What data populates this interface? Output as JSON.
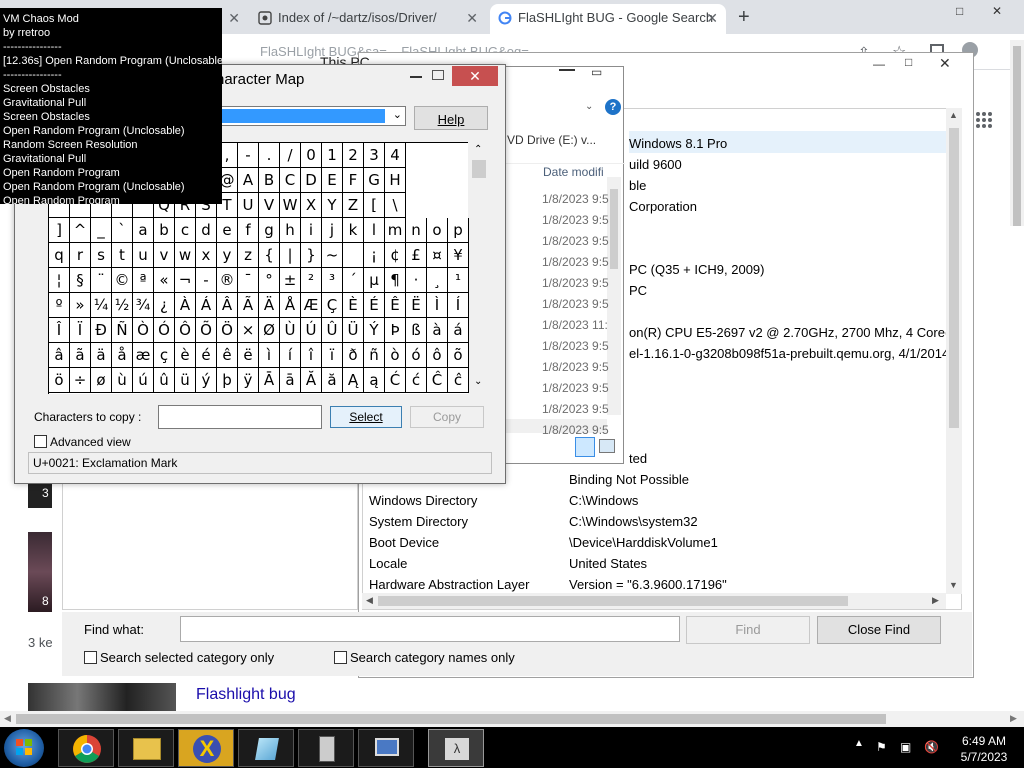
{
  "chrome": {
    "tabs": [
      {
        "label": ""
      },
      {
        "label": "Index of /~dartz/isos/Driver/"
      },
      {
        "label": "FlaSHLIght BUG - Google Search"
      }
    ],
    "address_ghost": "FlaSHLIght BUG&sa=... FlaSHLIght BUG&oq=..."
  },
  "chaos_overlay": {
    "title": "VM Chaos Mod",
    "author": "by rretroo",
    "separator": "----------------",
    "current": "[12.36s] Open Random Program (Unclosable)",
    "history": [
      "Screen Obstacles",
      "Gravitational Pull",
      "Screen Obstacles",
      "Open Random Program (Unclosable)",
      "Random Screen Resolution",
      "Gravitational Pull",
      "Open Random Program",
      "Open Random Program (Unclosable)",
      "Open Random Program"
    ]
  },
  "charmap": {
    "title": "haracter Map",
    "help_label": "Help",
    "copy_label": "Characters to copy :",
    "copy_value": "",
    "select_label": "Select",
    "copy_button": "Copy",
    "advanced_label": "Advanced view",
    "status": "U+0021: Exclamation Mark",
    "rows": [
      [
        "",
        "",
        "",
        "",
        "",
        ")",
        "*",
        "+",
        ",",
        "-",
        ".",
        "/",
        "0",
        "1",
        "2",
        "3",
        "4"
      ],
      [
        "",
        "",
        "",
        "",
        "",
        "=",
        ">",
        "?",
        "@",
        "A",
        "B",
        "C",
        "D",
        "E",
        "F",
        "G",
        "H"
      ],
      [
        "",
        "",
        "",
        "",
        "",
        "Q",
        "R",
        "S",
        "T",
        "U",
        "V",
        "W",
        "X",
        "Y",
        "Z",
        "[",
        "\\"
      ],
      [
        "]",
        "^",
        "_",
        "`",
        "a",
        "b",
        "c",
        "d",
        "e",
        "f",
        "g",
        "h",
        "i",
        "j",
        "k",
        "l",
        "m",
        "n",
        "o",
        "p"
      ],
      [
        "q",
        "r",
        "s",
        "t",
        "u",
        "v",
        "w",
        "x",
        "y",
        "z",
        "{",
        "|",
        "}",
        "~",
        "",
        "¡",
        "¢",
        "£",
        "¤",
        "¥"
      ],
      [
        "¦",
        "§",
        "¨",
        "©",
        "ª",
        "«",
        "¬",
        "-",
        "®",
        "¯",
        "°",
        "±",
        "²",
        "³",
        "´",
        "µ",
        "¶",
        "·",
        "¸",
        "¹"
      ],
      [
        "º",
        "»",
        "¼",
        "½",
        "¾",
        "¿",
        "À",
        "Á",
        "Â",
        "Ã",
        "Ä",
        "Å",
        "Æ",
        "Ç",
        "È",
        "É",
        "Ê",
        "Ë",
        "Ì",
        "Í"
      ],
      [
        "Î",
        "Ï",
        "Ð",
        "Ñ",
        "Ò",
        "Ó",
        "Ô",
        "Õ",
        "Ö",
        "×",
        "Ø",
        "Ù",
        "Ú",
        "Û",
        "Ü",
        "Ý",
        "Þ",
        "ß",
        "à",
        "á"
      ],
      [
        "â",
        "ã",
        "ä",
        "å",
        "æ",
        "ç",
        "è",
        "é",
        "ê",
        "ë",
        "ì",
        "í",
        "î",
        "ï",
        "ð",
        "ñ",
        "ò",
        "ó",
        "ô",
        "õ"
      ],
      [
        "ö",
        "÷",
        "ø",
        "ù",
        "ú",
        "û",
        "ü",
        "ý",
        "þ",
        "ÿ",
        "Ā",
        "ā",
        "Ă",
        "ă",
        "Ą",
        "ą",
        "Ć",
        "ć",
        "Ĉ",
        "ĉ"
      ]
    ]
  },
  "explorer": {
    "title": "This PC",
    "search_text": "VD Drive (E:) v...",
    "column": "Date modifi",
    "dates": [
      "1/8/2023 9:5",
      "1/8/2023 9:5",
      "1/8/2023 9:5",
      "1/8/2023 9:5",
      "1/8/2023 9:5",
      "1/8/2023 9:5",
      "1/8/2023 11:",
      "1/8/2023 9:5",
      "1/8/2023 9:5",
      "1/8/2023 9:5",
      "1/8/2023 9:5",
      "1/8/2023 9:5"
    ]
  },
  "sysinfo": {
    "top_values": [
      "Windows 8.1 Pro",
      "uild 9600",
      "ble",
      "Corporation",
      "",
      "",
      "PC (Q35 + ICH9, 2009)",
      "PC",
      "",
      "on(R) CPU E5-2697 v2 @ 2.70GHz, 2700 Mhz, 4 Core(s)",
      "el-1.16.1-0-g3208b098f51a-prebuilt.qemu.org, 4/1/2014"
    ],
    "partial_value": "ted",
    "rows": [
      {
        "item": "",
        "value": "Binding Not Possible"
      },
      {
        "item": "Windows Directory",
        "value": "C:\\Windows"
      },
      {
        "item": "System Directory",
        "value": "C:\\Windows\\system32"
      },
      {
        "item": "Boot Device",
        "value": "\\Device\\HarddiskVolume1"
      },
      {
        "item": "Locale",
        "value": "United States"
      },
      {
        "item": "Hardware Abstraction Layer",
        "value": "Version = \"6.3.9600.17196\""
      }
    ],
    "find_label": "Find what:",
    "find_value": "",
    "find_button": "Find",
    "close_find_button": "Close Find",
    "search_selected": "Search selected category only",
    "search_names": "Search category names only"
  },
  "google": {
    "result_title": "Flashlight bug",
    "result_count": "3 ke",
    "thumb1_badge": "3",
    "thumb2_badge": "8"
  },
  "taskbar": {
    "time": "6:49 AM",
    "date": "5/7/2023"
  }
}
